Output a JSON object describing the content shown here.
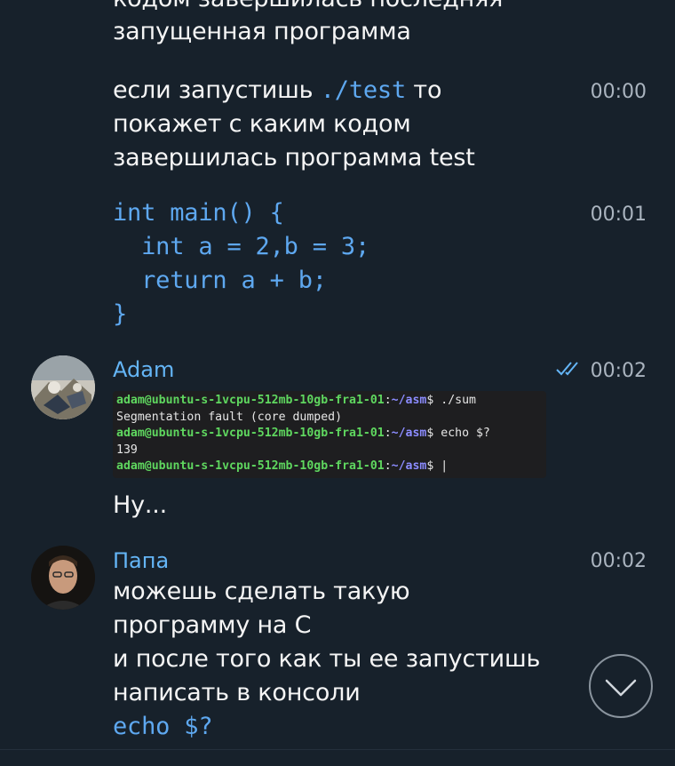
{
  "messages": {
    "m1": {
      "line_cut": "кодом завершилась последняя",
      "line2": "запущенная программа"
    },
    "m2": {
      "part1": "если запустишь ",
      "code": "./test",
      "part2": " то",
      "line2": "покажет с каким кодом",
      "line3": "завершилась программа test",
      "time": "00:00"
    },
    "m3": {
      "code_lines": [
        "int main() {",
        "  int a = 2,b = 3;",
        "  return a + b;",
        "}"
      ],
      "time": "00:01"
    },
    "m4": {
      "sender": "Adam",
      "time": "00:02",
      "read_icon": "double-check-icon",
      "terminal": {
        "prompt_user": "adam@ubuntu-s-1vcpu-512mb-10gb-fra1-01",
        "prompt_sep": ":",
        "prompt_path": "~/asm",
        "prompt_end": "$ ",
        "cmd1": "./sum",
        "out1": "Segmentation fault (core dumped)",
        "cmd2": "echo $?",
        "out2": "139",
        "cursor": "|"
      },
      "text": "Ну..."
    },
    "m5": {
      "sender": "Папа",
      "time": "00:02",
      "lines": [
        "можешь сделать такую",
        "программу на С",
        "и после того как ты ее запустишь",
        "написать в консоли"
      ],
      "code": "echo $?"
    }
  },
  "scroll_down_icon": "chevron-down-icon",
  "colors": {
    "background": "#17212b",
    "accent": "#5ea8f0",
    "timestamp": "#aab4bf"
  }
}
